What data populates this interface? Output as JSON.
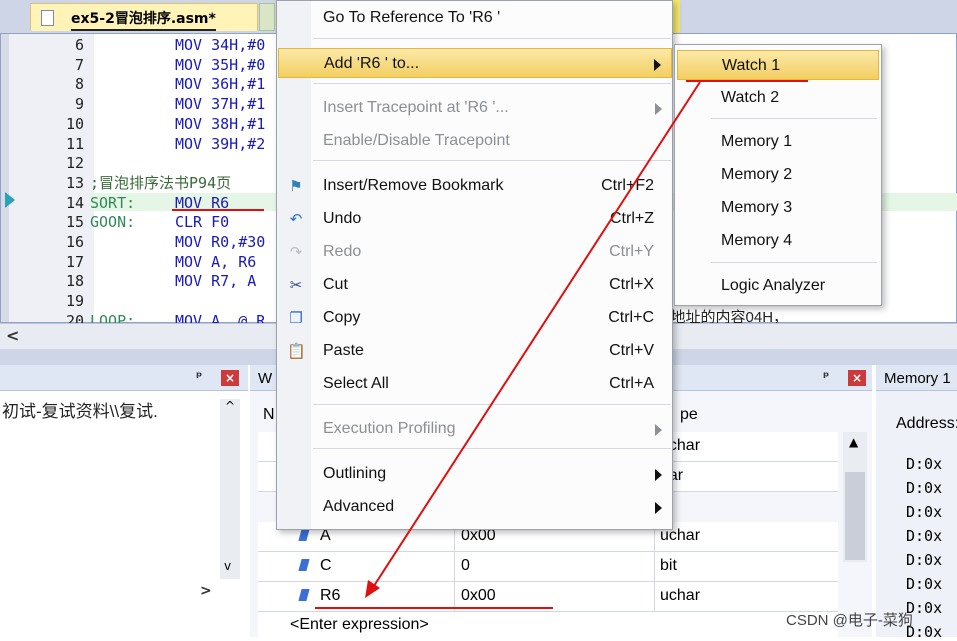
{
  "editor": {
    "tab_title": "ex5-2冒泡排序.asm*",
    "lines": [
      {
        "num": "6",
        "label": "",
        "code": "MOV 34H,#0"
      },
      {
        "num": "7",
        "label": "",
        "code": "MOV 35H,#0"
      },
      {
        "num": "8",
        "label": "",
        "code": "MOV 36H,#1"
      },
      {
        "num": "9",
        "label": "",
        "code": "MOV 37H,#1"
      },
      {
        "num": "10",
        "label": "",
        "code": "MOV 38H,#1"
      },
      {
        "num": "11",
        "label": "",
        "code": "MOV 39H,#2"
      },
      {
        "num": "12",
        "label": "",
        "code": ""
      },
      {
        "num": "13",
        "label": ";冒泡排序法书P94页",
        "code": ""
      },
      {
        "num": "14",
        "label": "SORT:",
        "code": "MOV R6"
      },
      {
        "num": "15",
        "label": "GOON:",
        "code": "CLR F0"
      },
      {
        "num": "16",
        "label": "",
        "code": "MOV R0,#30"
      },
      {
        "num": "17",
        "label": "",
        "code": "MOV A, R6"
      },
      {
        "num": "18",
        "label": "",
        "code": "MOV R7, A"
      },
      {
        "num": "19",
        "label": "",
        "code": ""
      },
      {
        "num": "20",
        "label": "LOOP:",
        "code": "MOV A, @ R"
      }
    ],
    "overflow_comment": "址，把30H这个地址的内容04H，"
  },
  "left_panel": {
    "path_text": "初试-复试资料\\\\复试."
  },
  "watch_panel": {
    "title": "W",
    "col_name_fragment": "N",
    "col_type_fragment": "pe",
    "rows": [
      {
        "name": "",
        "value": "",
        "type": "uchar"
      },
      {
        "name": "",
        "value": "",
        "type": "har"
      },
      {
        "name": "A",
        "value": "0x00",
        "type": "uchar"
      },
      {
        "name": "C",
        "value": "0",
        "type": "bit"
      },
      {
        "name": "R6",
        "value": "0x00",
        "type": "uchar"
      }
    ],
    "enter_expression": "<Enter expression>"
  },
  "memory_panel": {
    "title": "Memory 1",
    "address_label": "Address:",
    "rows": [
      "D:0x",
      "D:0x",
      "D:0x",
      "D:0x",
      "D:0x",
      "D:0x",
      "D:0x",
      "D:0x"
    ]
  },
  "context_menu": {
    "items": [
      {
        "label": "Go To Reference To 'R6    '",
        "shortcut": "",
        "icon": "",
        "disabled": false,
        "submenu": false
      },
      {
        "label": "Add 'R6    ' to...",
        "shortcut": "",
        "icon": "",
        "disabled": false,
        "submenu": true,
        "highlighted": true
      },
      {
        "label": "Insert Tracepoint at 'R6    '...",
        "shortcut": "",
        "icon": "",
        "disabled": true,
        "submenu": true
      },
      {
        "label": "Enable/Disable Tracepoint",
        "shortcut": "",
        "icon": "",
        "disabled": true,
        "submenu": false
      },
      {
        "label": "Insert/Remove Bookmark",
        "shortcut": "Ctrl+F2",
        "icon": "bookmark-flag-icon",
        "disabled": false,
        "submenu": false
      },
      {
        "label": "Undo",
        "shortcut": "Ctrl+Z",
        "icon": "undo-icon",
        "disabled": false,
        "submenu": false
      },
      {
        "label": "Redo",
        "shortcut": "Ctrl+Y",
        "icon": "redo-icon",
        "disabled": true,
        "submenu": false
      },
      {
        "label": "Cut",
        "shortcut": "Ctrl+X",
        "icon": "scissors-icon",
        "disabled": false,
        "submenu": false
      },
      {
        "label": "Copy",
        "shortcut": "Ctrl+C",
        "icon": "copy-icon",
        "disabled": false,
        "submenu": false
      },
      {
        "label": "Paste",
        "shortcut": "Ctrl+V",
        "icon": "paste-icon",
        "disabled": false,
        "submenu": false
      },
      {
        "label": "Select All",
        "shortcut": "Ctrl+A",
        "icon": "",
        "disabled": false,
        "submenu": false
      },
      {
        "label": "Execution Profiling",
        "shortcut": "",
        "icon": "",
        "disabled": true,
        "submenu": true
      },
      {
        "label": "Outlining",
        "shortcut": "",
        "icon": "",
        "disabled": false,
        "submenu": true
      },
      {
        "label": "Advanced",
        "shortcut": "",
        "icon": "",
        "disabled": false,
        "submenu": true
      }
    ]
  },
  "submenu": {
    "items": [
      {
        "label": "Watch 1",
        "highlighted": true
      },
      {
        "label": "Watch 2"
      },
      {
        "label": "Memory 1"
      },
      {
        "label": "Memory 2"
      },
      {
        "label": "Memory 3"
      },
      {
        "label": "Memory 4"
      },
      {
        "label": "Logic Analyzer"
      }
    ]
  },
  "watermark": "CSDN @电子-菜狗",
  "colors": {
    "highlight": "#f3cf62",
    "annotation_red": "#e01010"
  }
}
